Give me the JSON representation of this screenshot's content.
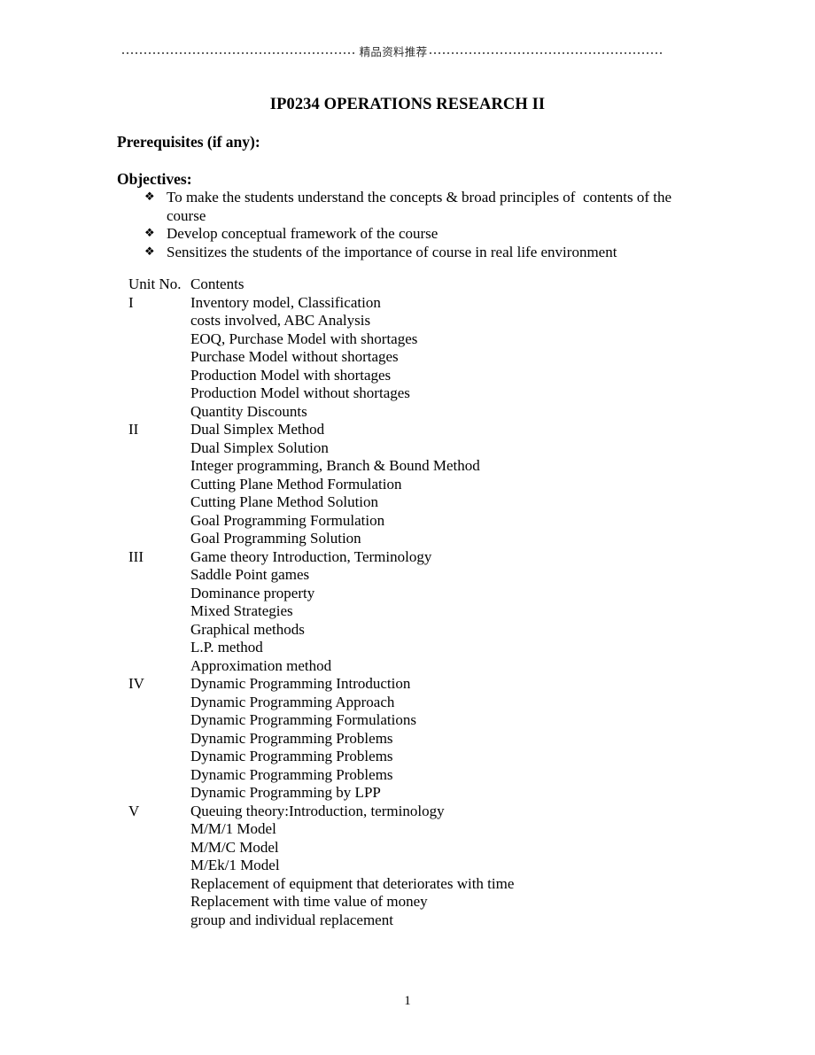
{
  "header": {
    "center_text": "精品资料推荐",
    "left_rule": "dotted-rule",
    "right_rule": "dotted-rule"
  },
  "title": "IP0234 OPERATIONS RESEARCH II",
  "sections": {
    "prerequisites_heading": "Prerequisites (if any):",
    "objectives_heading": "Objectives:"
  },
  "objectives": {
    "bullet_glyph": "❖",
    "items": [
      "To make the students understand the concepts & broad principles of  contents of the course",
      "Develop conceptual framework of the course",
      "Sensitizes the students of the importance of course in real life environment"
    ]
  },
  "units_table": {
    "headers": {
      "unit_no": "Unit No.",
      "contents": "Contents"
    },
    "rows": [
      {
        "unit": "I",
        "contents": [
          "Inventory model, Classification",
          "costs involved, ABC Analysis",
          "EOQ, Purchase Model with shortages",
          "Purchase Model without shortages",
          "Production Model with shortages",
          "Production Model without shortages",
          "Quantity Discounts"
        ]
      },
      {
        "unit": "II",
        "contents": [
          "Dual Simplex Method",
          "Dual Simplex Solution",
          "Integer programming, Branch & Bound Method",
          "Cutting Plane Method Formulation",
          "Cutting Plane Method Solution",
          "Goal Programming Formulation",
          "Goal Programming Solution"
        ]
      },
      {
        "unit": "III",
        "contents": [
          "Game theory Introduction, Terminology",
          "Saddle Point games",
          "Dominance property",
          "Mixed Strategies",
          "Graphical methods",
          "L.P. method",
          "Approximation method"
        ]
      },
      {
        "unit": "IV",
        "contents": [
          "Dynamic Programming Introduction",
          "Dynamic Programming Approach",
          "Dynamic Programming Formulations",
          "Dynamic Programming Problems",
          "Dynamic Programming Problems",
          "Dynamic Programming Problems",
          "Dynamic Programming by LPP"
        ]
      },
      {
        "unit": "V",
        "contents": [
          "Queuing theory:Introduction, terminology",
          "M/M/1 Model",
          "M/M/C Model",
          "M/Ek/1 Model",
          "Replacement of equipment that deteriorates with time",
          "Replacement with time value of money",
          "group and individual replacement"
        ]
      }
    ]
  },
  "footer": {
    "page_number": "1"
  }
}
